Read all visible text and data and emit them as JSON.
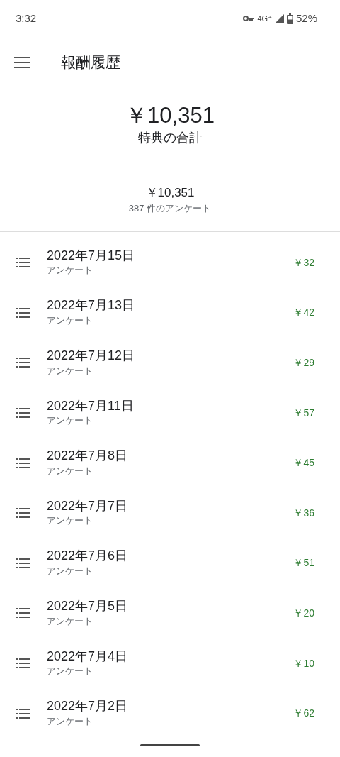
{
  "status_bar": {
    "time": "3:32",
    "network": "4G⁺",
    "battery": "52%"
  },
  "app_bar": {
    "title": "報酬履歴"
  },
  "total": {
    "amount": "￥10,351",
    "label": "特典の合計"
  },
  "summary": {
    "amount": "￥10,351",
    "count": "387 件のアンケート"
  },
  "rewards": [
    {
      "date": "2022年7月15日",
      "type": "アンケート",
      "amount": "￥32"
    },
    {
      "date": "2022年7月13日",
      "type": "アンケート",
      "amount": "￥42"
    },
    {
      "date": "2022年7月12日",
      "type": "アンケート",
      "amount": "￥29"
    },
    {
      "date": "2022年7月11日",
      "type": "アンケート",
      "amount": "￥57"
    },
    {
      "date": "2022年7月8日",
      "type": "アンケート",
      "amount": "￥45"
    },
    {
      "date": "2022年7月7日",
      "type": "アンケート",
      "amount": "￥36"
    },
    {
      "date": "2022年7月6日",
      "type": "アンケート",
      "amount": "￥51"
    },
    {
      "date": "2022年7月5日",
      "type": "アンケート",
      "amount": "￥20"
    },
    {
      "date": "2022年7月4日",
      "type": "アンケート",
      "amount": "￥10"
    },
    {
      "date": "2022年7月2日",
      "type": "アンケート",
      "amount": "￥62"
    }
  ]
}
